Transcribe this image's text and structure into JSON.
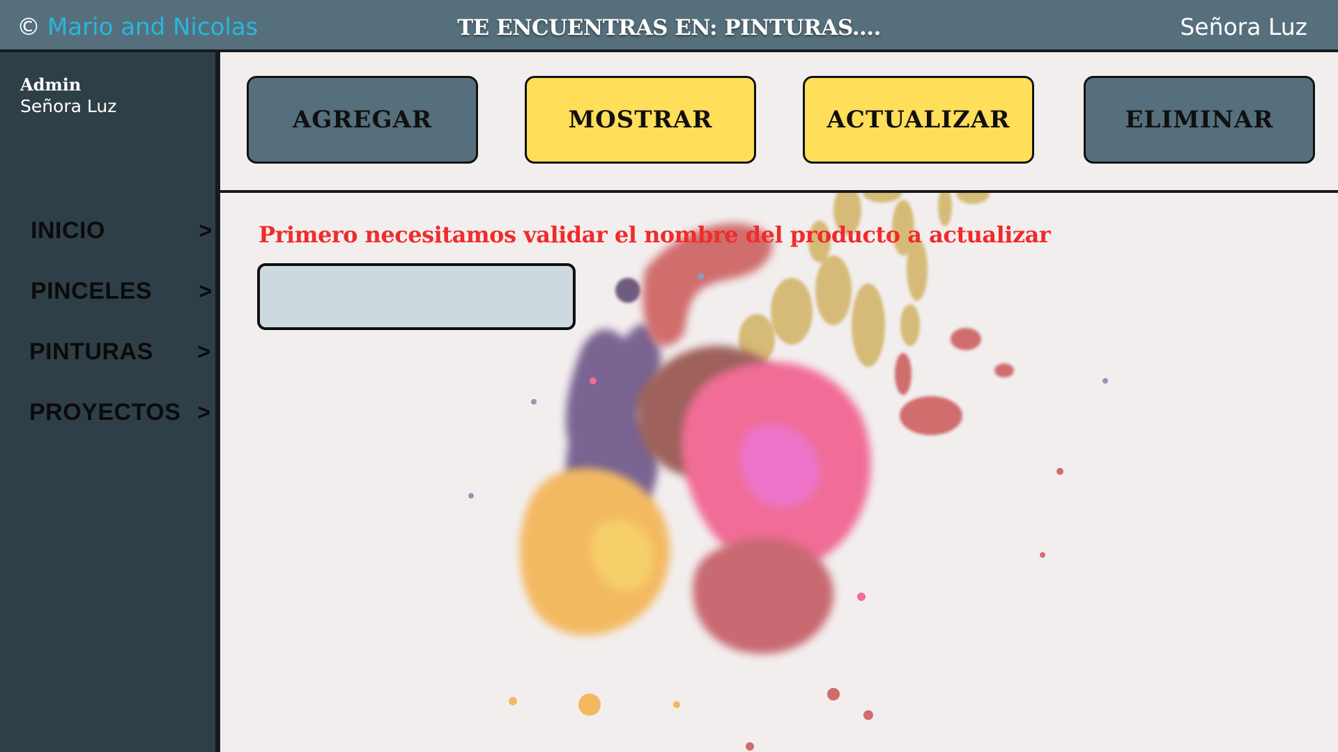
{
  "header": {
    "copyright_symbol": "©",
    "brand": "Mario and Nicolas",
    "location": "TE ENCUENTRAS EN: PINTURAS....",
    "user": "Señora Luz"
  },
  "sidebar": {
    "role": "Admin",
    "user": "Señora Luz",
    "items": [
      {
        "label": "INICIO",
        "arrow": ">"
      },
      {
        "label": "PINCELES",
        "arrow": ">"
      },
      {
        "label": "PINTURAS",
        "arrow": ">"
      },
      {
        "label": "PROYECTOS",
        "arrow": ">"
      }
    ]
  },
  "actions": {
    "add": "AGREGAR",
    "show": "MOSTRAR",
    "update": "ACTUALIZAR",
    "delete": "ELIMINAR"
  },
  "form": {
    "prompt": "Primero necesitamos validar el nombre del producto a actualizar",
    "product_name_value": "",
    "product_name_placeholder": ""
  },
  "colors": {
    "header_bg": "#566f7c",
    "sidebar_bg": "#2f3f47",
    "brand_text": "#27b7de",
    "button_slate": "#566f7c",
    "button_yellow": "#ffde59",
    "prompt_text": "#f02b2b",
    "input_bg": "#ccd9de",
    "content_bg": "#f3eeee"
  },
  "icons": {
    "background_art": "paint-splash",
    "nav_arrow": "chevron-right"
  }
}
